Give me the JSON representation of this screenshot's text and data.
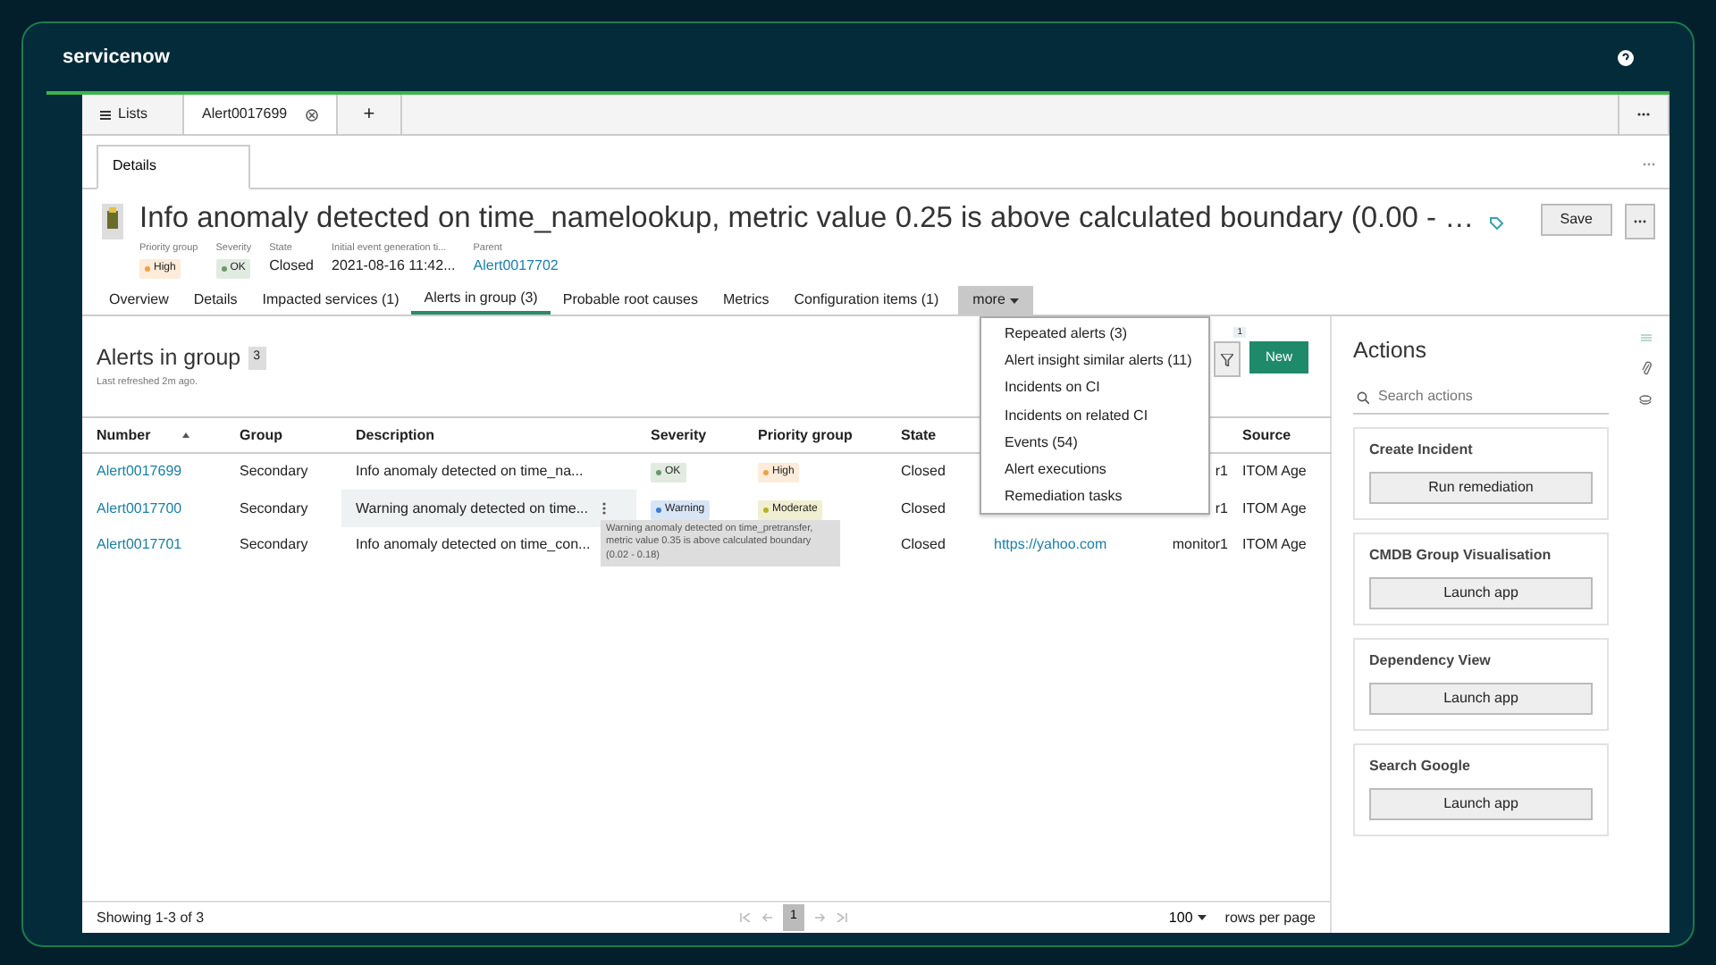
{
  "app_bar": {
    "logo": "servicenow"
  },
  "tab_bar": {
    "lists": "Lists",
    "tabs": [
      {
        "label": "Alert0017699",
        "selected": true
      }
    ],
    "add": "+"
  },
  "sub_tabs": [
    {
      "label": "Details",
      "selected": true
    }
  ],
  "record": {
    "title": "Info anomaly detected on time_namelookup, metric value 0.25 is above calculated boundary (0.00 - …",
    "save": "Save",
    "fields": [
      {
        "label": "Priority group",
        "value": "High",
        "kind": "badge",
        "color": "#f0a040"
      },
      {
        "label": "Severity",
        "value": "OK",
        "kind": "badge",
        "color": "#6a9a6a"
      },
      {
        "label": "State",
        "value": "Closed",
        "kind": "text"
      },
      {
        "label": "Initial event generation ti...",
        "value": "2021-08-16 11:42...",
        "kind": "text"
      },
      {
        "label": "Parent",
        "value": "Alert0017702",
        "kind": "link"
      }
    ]
  },
  "tabs": [
    {
      "label": "Overview",
      "selected": false
    },
    {
      "label": "Details",
      "selected": false
    },
    {
      "label": "Impacted services (1)",
      "selected": false
    },
    {
      "label": "Alerts in group (3)",
      "selected": true
    },
    {
      "label": "Probable root causes",
      "selected": false
    },
    {
      "label": "Metrics",
      "selected": false
    },
    {
      "label": "Configuration items (1)",
      "selected": false
    }
  ],
  "more": {
    "label": "more",
    "expanded": true,
    "items": [
      "Repeated alerts (3)",
      "Alert insight similar alerts (11)",
      "Incidents on CI",
      "Incidents on related CI",
      "Events (54)",
      "Alert executions",
      "Remediation tasks"
    ]
  },
  "list": {
    "title": "Alerts in group",
    "count": "3",
    "refreshed": "Last refreshed 2m ago.",
    "filter_count": "1",
    "new_button": "New",
    "columns": [
      "Number",
      "Group",
      "Description",
      "Severity",
      "Priority group",
      "State",
      null,
      null,
      "Source"
    ],
    "rows": [
      {
        "number": "Alert0017699",
        "group": "Secondary",
        "description": "Info anomaly detected on time_na...",
        "severity": {
          "label": "OK",
          "color": "#6a9a6a"
        },
        "priority": {
          "label": "High",
          "color": "#f0a040"
        },
        "state": "Closed",
        "column_8": "r1",
        "source": "ITOM Age",
        "hovered": false
      },
      {
        "number": "Alert0017700",
        "group": "Secondary",
        "description": "Warning anomaly detected on time...",
        "severity": {
          "label": "Warning",
          "color": "#3a7fd0"
        },
        "priority": {
          "label": "Moderate",
          "color": "#b8b020"
        },
        "state": "Closed",
        "column_8": "r1",
        "source": "ITOM Age",
        "hovered": true
      },
      {
        "number": "Alert0017701",
        "group": "Secondary",
        "description": "Info anomaly detected on time_con...",
        "state": "Closed",
        "column_7": "https://yahoo.com",
        "column_8": "monitor1",
        "source": "ITOM Age",
        "hovered": false
      }
    ],
    "tooltip": "Warning anomaly detected on time_pretransfer, metric value 0.35 is above calculated boundary (0.02 - 0.18)",
    "footer": {
      "showing": "Showing 1-3 of 3",
      "page": "1",
      "rows_per_page": "100",
      "rows_per_page_label": "rows per page"
    }
  },
  "actions": {
    "title": "Actions",
    "search_placeholder": "Search actions",
    "cards": [
      {
        "title": "Create Incident",
        "button": "Run remediation"
      },
      {
        "title": "CMDB Group Visualisation",
        "button": "Launch app"
      },
      {
        "title": "Dependency View",
        "button": "Launch app"
      },
      {
        "title": "Search Google",
        "button": "Launch app"
      }
    ]
  }
}
